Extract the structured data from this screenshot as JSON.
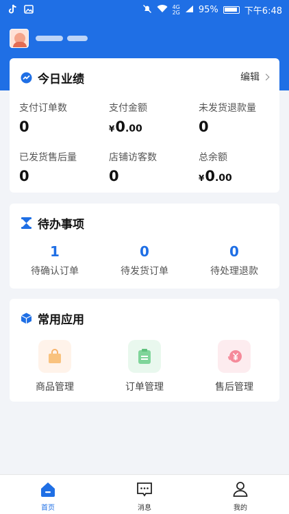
{
  "status_bar": {
    "battery": "95%",
    "time": "下午6:48",
    "net_top": "4G",
    "net_bottom": "2G"
  },
  "colors": {
    "primary": "#1f6fe5",
    "page_bg": "#f2f4f8"
  },
  "performance": {
    "title": "今日业绩",
    "edit_label": "编辑",
    "currency": "¥",
    "stats": [
      {
        "label": "支付订单数",
        "value": "0"
      },
      {
        "label": "支付金额",
        "int": "0",
        "dec": ".00"
      },
      {
        "label": "未发货退款量",
        "value": "0"
      },
      {
        "label": "已发货售后量",
        "value": "0"
      },
      {
        "label": "店铺访客数",
        "value": "0"
      },
      {
        "label": "总余额",
        "int": "0",
        "dec": ".00"
      }
    ]
  },
  "todo": {
    "title": "待办事项",
    "items": [
      {
        "count": "1",
        "label": "待确认订单"
      },
      {
        "count": "0",
        "label": "待发货订单"
      },
      {
        "count": "0",
        "label": "待处理退款"
      }
    ]
  },
  "apps": {
    "title": "常用应用",
    "items": [
      {
        "label": "商品管理",
        "icon": "shopping-bag-icon"
      },
      {
        "label": "订单管理",
        "icon": "clipboard-icon"
      },
      {
        "label": "售后管理",
        "icon": "refund-yen-icon"
      }
    ]
  },
  "tabs": [
    {
      "label": "首页",
      "icon": "home-icon",
      "active": true
    },
    {
      "label": "消息",
      "icon": "message-icon",
      "active": false
    },
    {
      "label": "我的",
      "icon": "user-icon",
      "active": false
    }
  ]
}
